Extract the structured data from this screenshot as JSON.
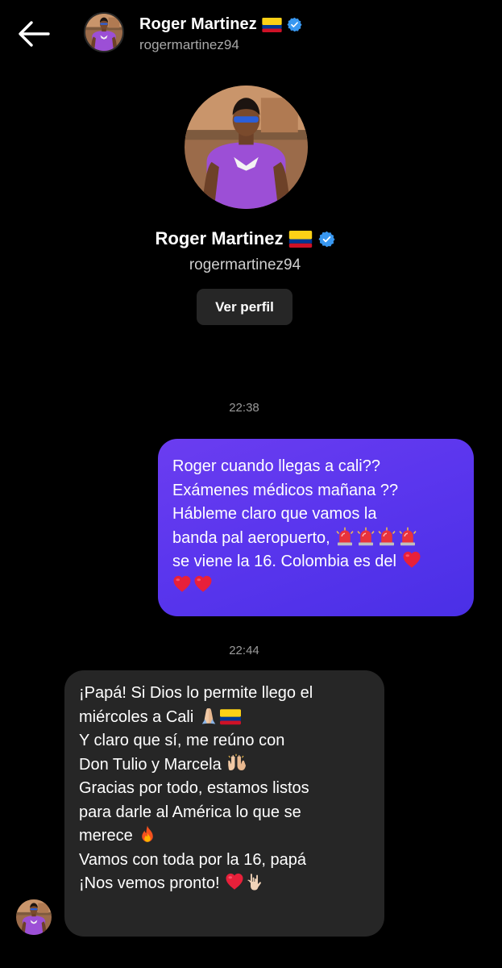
{
  "header": {
    "name": "Roger Martinez",
    "username": "rogermartinez94",
    "flag_icon": "colombia-flag-icon",
    "verified_icon": "verified-badge-icon",
    "back_icon": "arrow-left-icon"
  },
  "profile": {
    "name": "Roger Martinez",
    "username": "rogermartinez94",
    "view_profile_label": "Ver perfil"
  },
  "messages": [
    {
      "timestamp": "22:38",
      "direction": "outgoing",
      "lines": [
        "Roger cuando llegas a cali??",
        "Exámenes médicos mañana ??",
        "Hábleme claro que vamos la",
        "banda pal aeropuerto,",
        "se viene la 16. Colombia es del",
        ""
      ],
      "emojis": [
        "police-light",
        "police-light",
        "police-light",
        "police-light",
        "red-heart",
        "red-heart",
        "red-heart"
      ]
    },
    {
      "timestamp": "22:44",
      "direction": "incoming",
      "lines": [
        "¡Papá! Si Dios lo permite llego el",
        "miércoles a Cali",
        "Y claro que sí, me reúno con",
        "Don Tulio y Marcela",
        "Gracias por todo, estamos listos",
        "para darle al América lo que se",
        "merece",
        "Vamos con toda por la 16, papá",
        "¡Nos vemos pronto!"
      ],
      "emojis": [
        "folded-hands",
        "colombia-flag",
        "raising-hands",
        "fire",
        "red-heart",
        "love-you-gesture"
      ]
    }
  ],
  "colors": {
    "background": "#000000",
    "outgoing_bubble": "#5b36ee",
    "incoming_bubble": "#262626",
    "secondary_text": "#a8a8a8",
    "verified_blue": "#3897f0"
  }
}
